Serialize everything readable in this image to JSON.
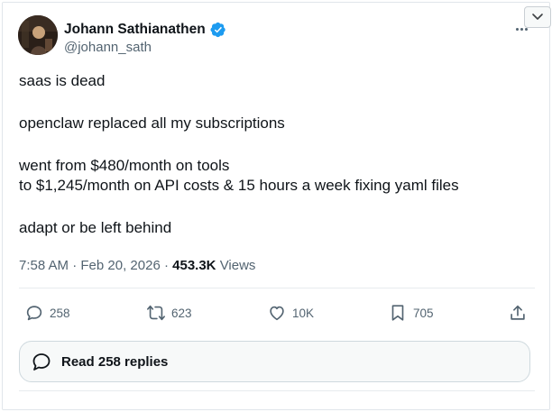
{
  "author": {
    "display_name": "Johann Sathianathen",
    "handle": "@johann_sath",
    "verified": true
  },
  "tweet": {
    "paragraphs": [
      {
        "lines": [
          "saas is dead"
        ]
      },
      {
        "lines": [
          "openclaw replaced all my subscriptions"
        ]
      },
      {
        "lines": [
          "went from $480/month on tools",
          "to $1,245/month on API costs & 15 hours a week fixing yaml files"
        ]
      },
      {
        "lines": [
          "adapt or be left behind"
        ]
      }
    ],
    "time": "7:58 AM",
    "date": "Feb 20, 2026",
    "separator": "·",
    "views_count": "453.3K",
    "views_label": "Views"
  },
  "actions": {
    "replies": "258",
    "reposts": "623",
    "likes": "10K",
    "bookmarks": "705"
  },
  "replies_button": {
    "label": "Read 258 replies"
  },
  "colors": {
    "verified_badge": "#1d9bf0",
    "text_primary": "#0f1419",
    "text_secondary": "#536471"
  },
  "icons": {
    "reply": "speech-bubble-icon",
    "repost": "repost-arrows-icon",
    "like": "heart-icon",
    "bookmark": "bookmark-icon",
    "share": "share-upload-icon",
    "more": "more-dots-icon",
    "menu": "chevron-down-icon"
  }
}
